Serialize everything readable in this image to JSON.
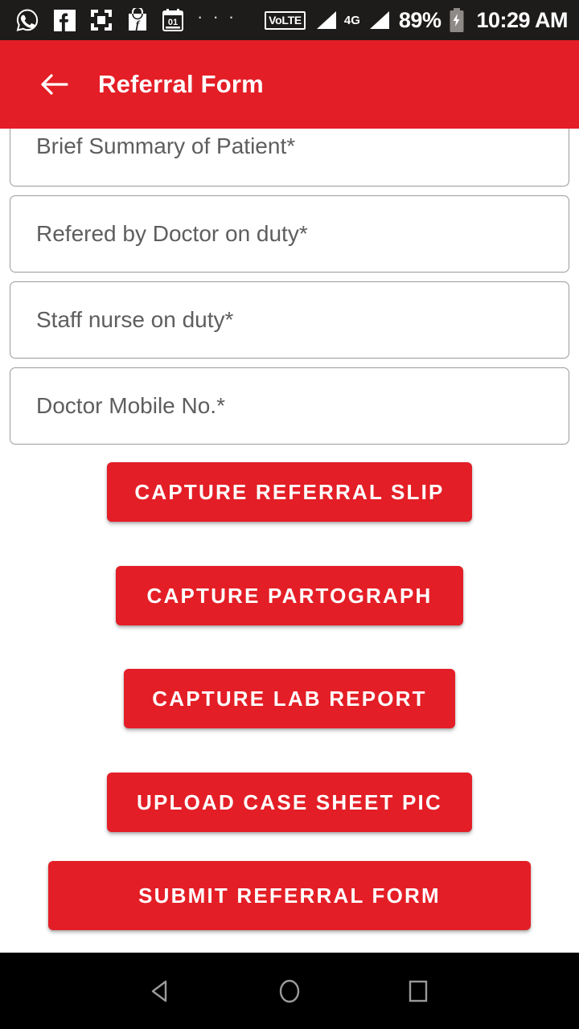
{
  "statusbar": {
    "left_icons": [
      {
        "name": "whatsapp-icon"
      },
      {
        "name": "facebook-icon"
      },
      {
        "name": "screen-capture-icon"
      },
      {
        "name": "flipkart-icon"
      },
      {
        "name": "calendar-icon",
        "day": "01"
      }
    ],
    "overflow": "· · ·",
    "volte": "VoLTE",
    "network_type": "4G",
    "battery_percent": "89%",
    "time": "10:29 AM"
  },
  "appbar": {
    "back_label": "Back",
    "title": "Referral Form",
    "background": "#e41e26"
  },
  "form": {
    "fields": [
      {
        "name": "brief-summary-of-patient",
        "placeholder": "Brief Summary of Patient*",
        "value": ""
      },
      {
        "name": "refered-by-doctor-on-duty",
        "placeholder": "Refered by Doctor on duty*",
        "value": ""
      },
      {
        "name": "staff-nurse-on-duty",
        "placeholder": "Staff nurse on duty*",
        "value": ""
      },
      {
        "name": "doctor-mobile-no",
        "placeholder": "Doctor Mobile No.*",
        "value": ""
      }
    ],
    "buttons": [
      {
        "name": "capture-referral-slip-button",
        "label": "CAPTURE REFERRAL SLIP"
      },
      {
        "name": "capture-partograph-button",
        "label": "CAPTURE PARTOGRAPH"
      },
      {
        "name": "capture-lab-report-button",
        "label": "CAPTURE LAB REPORT"
      },
      {
        "name": "upload-case-sheet-pic-button",
        "label": "UPLOAD CASE SHEET PIC"
      },
      {
        "name": "submit-referral-form-button",
        "label": "SUBMIT REFERRAL FORM"
      }
    ]
  },
  "navbar": {
    "back": "back-nav-icon",
    "home": "home-nav-icon",
    "recents": "recents-nav-icon"
  },
  "colors": {
    "accent_red": "#e41e26",
    "statusbar_bg": "#1e1c1b",
    "navbar_bg": "#000000",
    "field_border": "#9b9b9b",
    "placeholder_text": "#5e5e5e"
  }
}
